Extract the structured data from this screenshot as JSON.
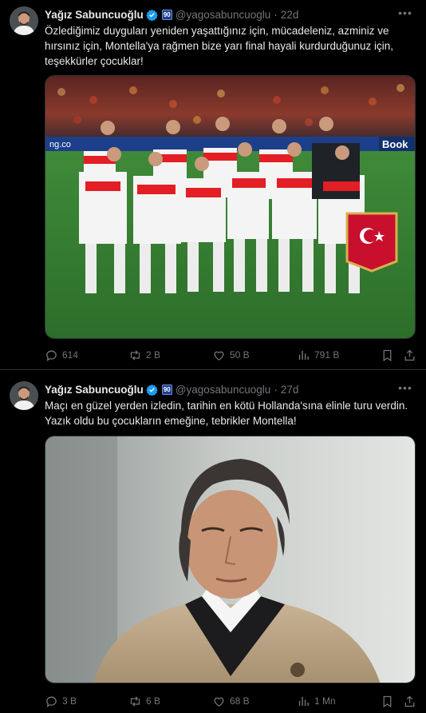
{
  "colors": {
    "background": "#000000",
    "text": "#e7e9ea",
    "secondary": "#71767b",
    "verified": "#1d9bf0",
    "divider": "#2f3336"
  },
  "tweets": [
    {
      "author": "Yağız Sabuncuoğlu",
      "handle": "@yagosabuncuoglu",
      "separator": "·",
      "time": "22d",
      "text": "Özlediğimiz duyguları yeniden yaşattığınız için, mücadeleniz, azminiz ve hırsınız için, Montella'ya rağmen bize yarı final hayali kurdurduğunuz için, teşekkürler çocuklar!",
      "media_sign": "Book",
      "media_sign_left": "ng.co",
      "stats": {
        "replies": "614",
        "retweets": "2 B",
        "likes": "50 B",
        "views": "791 B"
      }
    },
    {
      "author": "Yağız Sabuncuoğlu",
      "handle": "@yagosabuncuoglu",
      "separator": "·",
      "time": "27d",
      "text": "Maçı en güzel yerden izledin, tarihin en kötü Hollanda'sına elinle turu verdin. Yazık oldu bu çocukların emeğine, tebrikler Montella!",
      "stats": {
        "replies": "3 B",
        "retweets": "6 B",
        "likes": "68 B",
        "views": "1 Mn"
      }
    }
  ],
  "affiliate_badge": "90",
  "icons": [
    "verified-badge-icon",
    "more-icon",
    "reply-icon",
    "retweet-icon",
    "like-icon",
    "views-icon",
    "bookmark-icon",
    "share-icon"
  ]
}
